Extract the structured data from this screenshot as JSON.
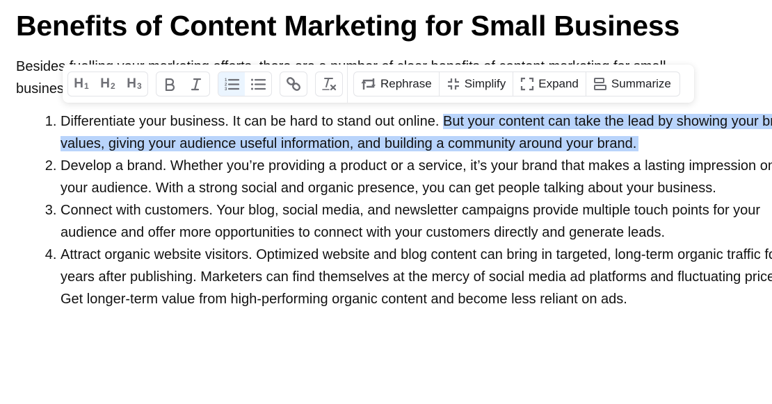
{
  "document": {
    "title": "Benefits of Content Marketing for Small Business",
    "intro": "Besides fuelling your marketing efforts, there are a number of clear benefits of content marketing for small business.",
    "list": [
      {
        "number": "1.",
        "before_selection": "Differentiate your business. It can be hard to stand out online. ",
        "selected": "But your content can take the lead by showing your brand values, giving your audience useful information, and building a community around your brand.",
        "after_selection": ""
      },
      {
        "number": "2.",
        "text": "Develop a brand. Whether you’re providing a product or a service, it’s your brand that makes a lasting impression on your audience. With a strong social and organic presence, you can get people talking about your business."
      },
      {
        "number": "3.",
        "text": "Connect with customers. Your blog, social media, and newsletter campaigns provide multiple touch points for your audience and offer more opportunities to connect with your customers directly and generate leads."
      },
      {
        "number": "4.",
        "text": "Attract organic website visitors. Optimized website and blog content can bring in targeted, long-term organic traffic for years after publishing. Marketers can find themselves at the mercy of social media ad platforms and fluctuating prices. Get longer-term value from high-performing organic content and become less reliant on ads."
      }
    ]
  },
  "toolbar": {
    "headings": [
      {
        "letter": "H",
        "level": "1",
        "icon": "heading-1-icon"
      },
      {
        "letter": "H",
        "level": "2",
        "icon": "heading-2-icon"
      },
      {
        "letter": "H",
        "level": "3",
        "icon": "heading-3-icon"
      }
    ],
    "formatting": [
      {
        "label": "B",
        "icon": "bold-icon"
      },
      {
        "label": "I",
        "icon": "italic-icon"
      }
    ],
    "lists": [
      {
        "icon": "ordered-list-icon",
        "active": true
      },
      {
        "icon": "bullet-list-icon",
        "active": false
      }
    ],
    "link": {
      "icon": "link-icon"
    },
    "clear_format": {
      "icon": "clear-formatting-icon"
    },
    "ai_actions": [
      {
        "label": "Rephrase",
        "icon": "rephrase-icon"
      },
      {
        "label": "Simplify",
        "icon": "simplify-icon"
      },
      {
        "label": "Expand",
        "icon": "expand-icon"
      },
      {
        "label": "Summarize",
        "icon": "summarize-icon"
      }
    ],
    "active_bg": "#ebf5ff",
    "selection_color": "#b9d4fb"
  }
}
